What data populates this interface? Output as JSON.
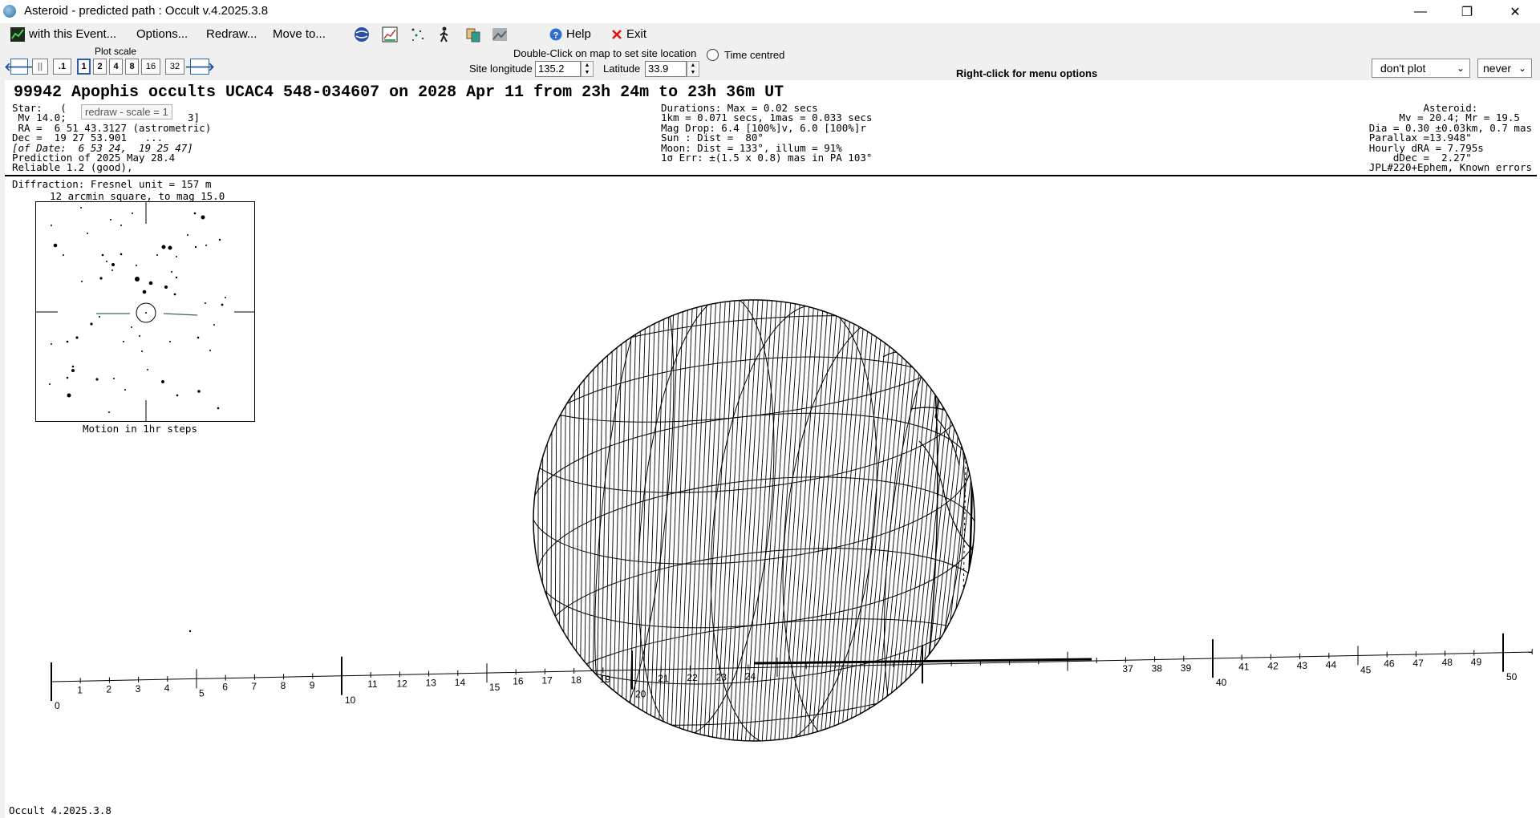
{
  "window": {
    "title": "Asteroid - predicted path : Occult v.4.2025.3.8"
  },
  "menu": {
    "with_event": "with this Event...",
    "options": "Options...",
    "redraw": "Redraw...",
    "move_to": "Move to...",
    "help": "Help",
    "exit": "Exit"
  },
  "toolbar": {
    "plot_scale_label": "Plot scale",
    "scale_buttons": [
      ".1",
      "1",
      "2",
      "4",
      "8",
      "16",
      "32"
    ],
    "tooltip": "redraw - scale = 1",
    "dblclick_hint": "Double-Click on map to set site location",
    "time_centred": "Time centred",
    "site_longitude_label": "Site longitude",
    "site_longitude": "135.2",
    "latitude_label": "Latitude",
    "latitude": "33.9",
    "right_click_hint": "Right-click for menu options",
    "plot_combo": "don't plot",
    "never_combo": "never"
  },
  "event": {
    "heading": "99942 Apophis occults UCAC4 548-034607 on 2028 Apr 11 from 23h 24m to 23h 36m UT",
    "star_lines": [
      "Star:   (",
      " Mv 14.0; ",
      " RA =  6 51 43.3127 (astrometric)",
      "Dec =  19 27 53.901   ...",
      "[of Date:  6 53 24,  19 25 47]",
      "Prediction of 2025 May 28.4",
      "Reliable 1.2 (good),"
    ],
    "star_fragment": "3]",
    "duration_lines": [
      "Durations: Max = 0.02 secs",
      "1km = 0.071 secs, 1mas = 0.033 secs",
      "Mag Drop: 6.4 [100%]v, 6.0 [100%]r",
      "Sun : Dist =  80°",
      "Moon: Dist = 133°, illum = 91%",
      "1σ Err: ±(1.5 x 0.8) mas in PA 103°"
    ],
    "asteroid_lines": [
      "Asteroid:         ",
      "Mv = 20.4; Mr = 19.5  ",
      "Dia = 0.30 ±0.03km, 0.7 mas",
      "Parallax =13.948\"          ",
      "Hourly dRA = 7.795s        ",
      "dDec =  2.27\"          ",
      "JPL#220+Ephem, Known errors"
    ]
  },
  "finder": {
    "diffraction": "Diffraction: Fresnel unit = 157 m",
    "title": "12 arcmin square, to mag 15.0",
    "motion_label": "Motion in 1hr steps"
  },
  "timeline": {
    "labels": [
      "0",
      "1",
      "2",
      "3",
      "4",
      "5",
      "6",
      "7",
      "8",
      "9",
      "10",
      "11",
      "12",
      "13",
      "14",
      "15",
      "16",
      "17",
      "18",
      "19",
      "20",
      "21",
      "22",
      "23",
      "24",
      "37",
      "38",
      "39",
      "40",
      "41",
      "42",
      "43",
      "44",
      "45",
      "46",
      "47",
      "48",
      "49",
      "50"
    ]
  },
  "footer": {
    "version": "Occult 4.2025.3.8"
  },
  "icons": [
    "globe-icon",
    "chart-icon",
    "stars-icon",
    "walker-icon",
    "copy-icon",
    "image-icon",
    "help-icon",
    "close-icon"
  ]
}
